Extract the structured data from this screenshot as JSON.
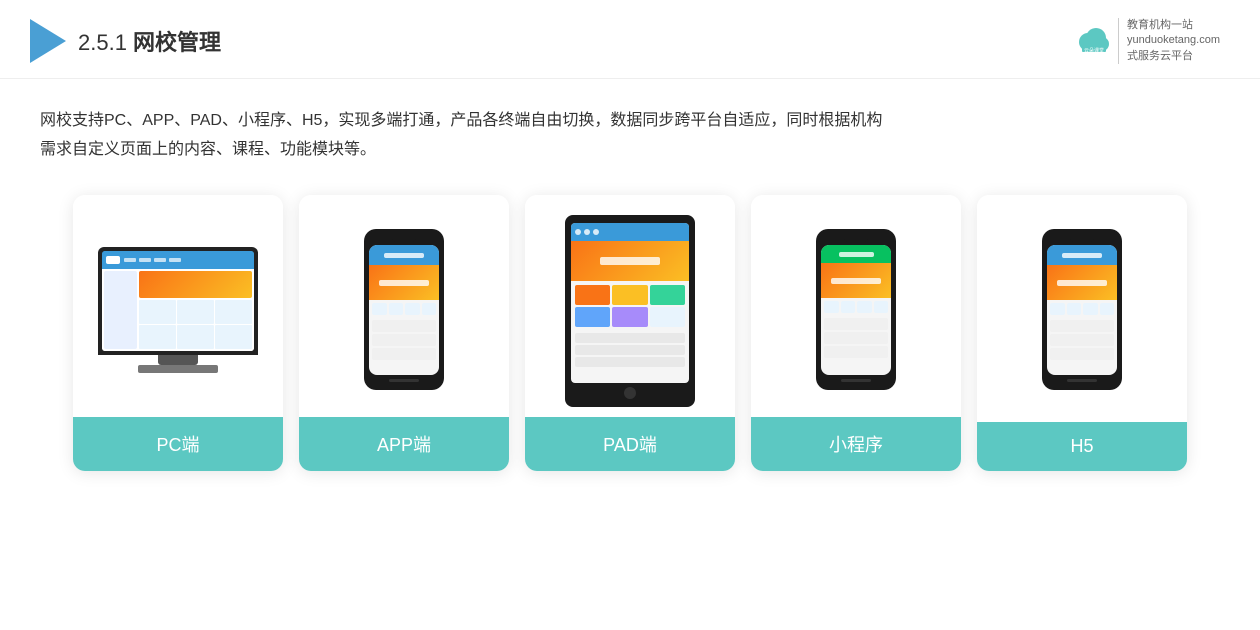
{
  "header": {
    "title_prefix": "2.5.1 ",
    "title_bold": "网校管理",
    "brand_name": "云朵课堂",
    "brand_url": "yunduoketang.com",
    "brand_tagline_1": "教育机构一站",
    "brand_tagline_2": "式服务云平台"
  },
  "description": {
    "text_line1": "网校支持PC、APP、PAD、小程序、H5，实现多端打通，产品各终端自由切换，数据同步跨平台自适应，同时根据机构",
    "text_line2": "需求自定义页面上的内容、课程、功能模块等。"
  },
  "cards": [
    {
      "id": "pc",
      "label": "PC端"
    },
    {
      "id": "app",
      "label": "APP端"
    },
    {
      "id": "pad",
      "label": "PAD端"
    },
    {
      "id": "miniprogram",
      "label": "小程序"
    },
    {
      "id": "h5",
      "label": "H5"
    }
  ],
  "colors": {
    "card_label_bg": "#5cc8c2",
    "accent_blue": "#3a9ad9",
    "accent_orange": "#f97316"
  }
}
